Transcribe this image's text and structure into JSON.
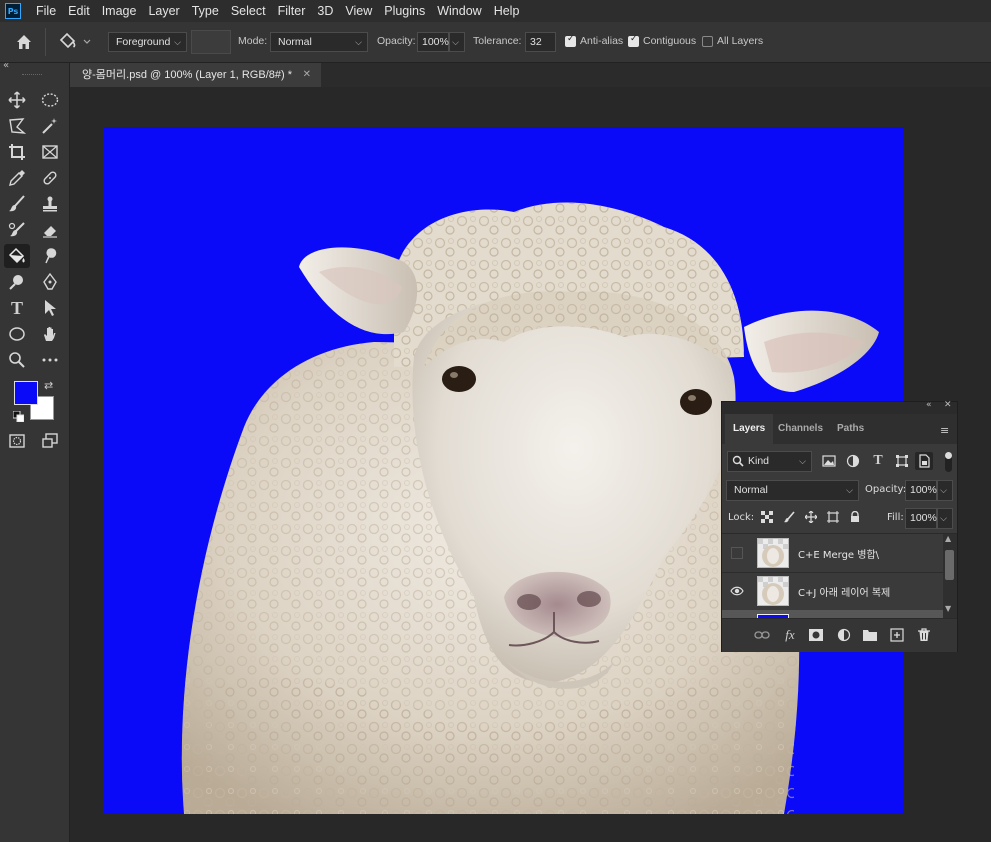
{
  "app": {
    "logo": "Ps"
  },
  "menu": [
    "File",
    "Edit",
    "Image",
    "Layer",
    "Type",
    "Select",
    "Filter",
    "3D",
    "View",
    "Plugins",
    "Window",
    "Help"
  ],
  "options": {
    "fill_source": "Foreground",
    "mode_label": "Mode:",
    "mode_value": "Normal",
    "opacity_label": "Opacity:",
    "opacity_value": "100%",
    "tolerance_label": "Tolerance:",
    "tolerance_value": "32",
    "antialias_label": "Anti-alias",
    "antialias_checked": true,
    "contiguous_label": "Contiguous",
    "contiguous_checked": true,
    "all_layers_label": "All Layers",
    "all_layers_checked": false
  },
  "document": {
    "tab_title": "양-몸머리.psd @ 100% (Layer 1, RGB/8#) *",
    "close_glyph": "✕",
    "background_color": "#0a0af8"
  },
  "toolbox": {
    "collapse_glyph": "«",
    "foreground_color": "#0a0af8",
    "background_color": "#ffffff",
    "active_tool": "paint-bucket"
  },
  "layers_panel": {
    "tabs": [
      "Layers",
      "Channels",
      "Paths"
    ],
    "active_tab": "Layers",
    "filter_kind": "Kind",
    "blend_mode": "Normal",
    "opacity_label": "Opacity:",
    "opacity_value": "100%",
    "lock_label": "Lock:",
    "fill_label": "Fill:",
    "fill_value": "100%",
    "layers": [
      {
        "name": "C+E Merge 병합\\",
        "visible": false
      },
      {
        "name": "C+J 아래 레이어 복제",
        "visible": true
      },
      {
        "name": "",
        "visible": true
      }
    ]
  }
}
